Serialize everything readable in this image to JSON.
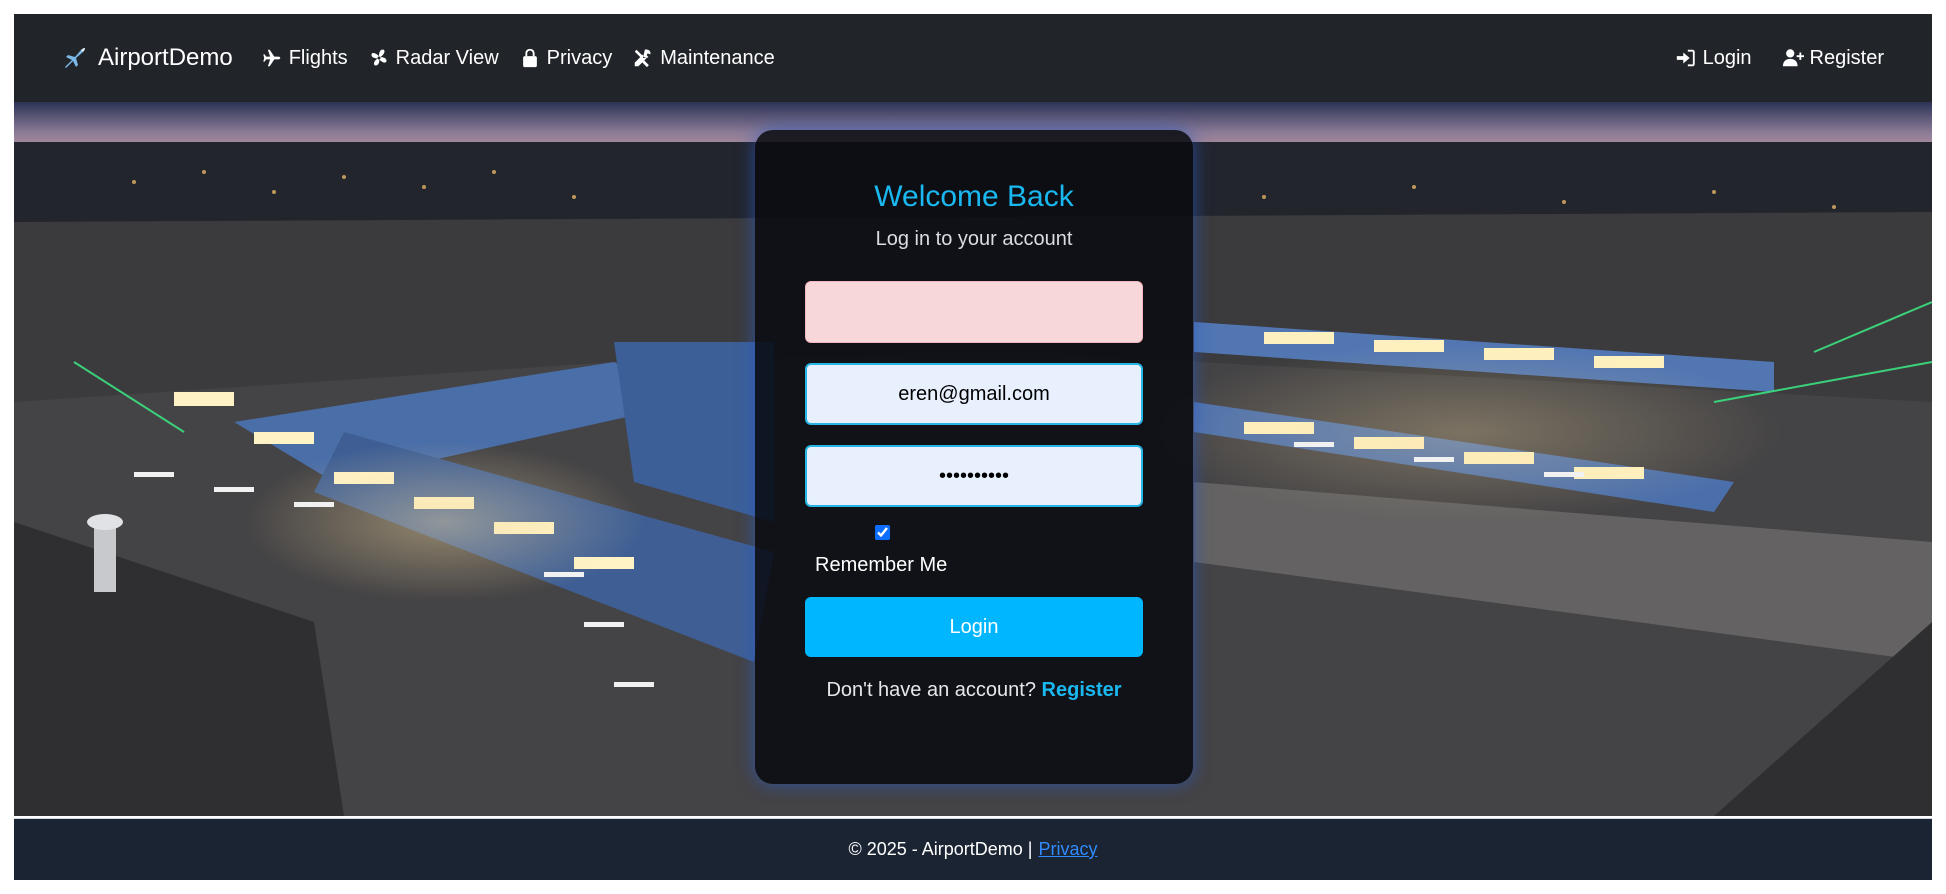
{
  "navbar": {
    "brand": "AirportDemo",
    "links": [
      {
        "label": "Flights",
        "icon": "plane-icon"
      },
      {
        "label": "Radar View",
        "icon": "fan-icon"
      },
      {
        "label": "Privacy",
        "icon": "lock-icon"
      },
      {
        "label": "Maintenance",
        "icon": "tools-icon"
      }
    ],
    "right_links": [
      {
        "label": "Login",
        "icon": "sign-in-icon"
      },
      {
        "label": "Register",
        "icon": "user-plus-icon"
      }
    ]
  },
  "login": {
    "title": "Welcome Back",
    "subtitle": "Log in to your account",
    "username_value": "",
    "email_value": "eren@gmail.com",
    "password_value": "••••••••••",
    "remember_label": "Remember Me",
    "remember_checked": true,
    "submit_label": "Login",
    "no_account_text": "Don't have an account?",
    "register_link": "Register"
  },
  "footer": {
    "text": "© 2025 - AirportDemo |",
    "privacy_link": "Privacy"
  },
  "colors": {
    "navbar_bg": "#212529",
    "accent": "#1ab8f0",
    "button": "#00b7ff",
    "footer_bg": "#1b2433"
  }
}
